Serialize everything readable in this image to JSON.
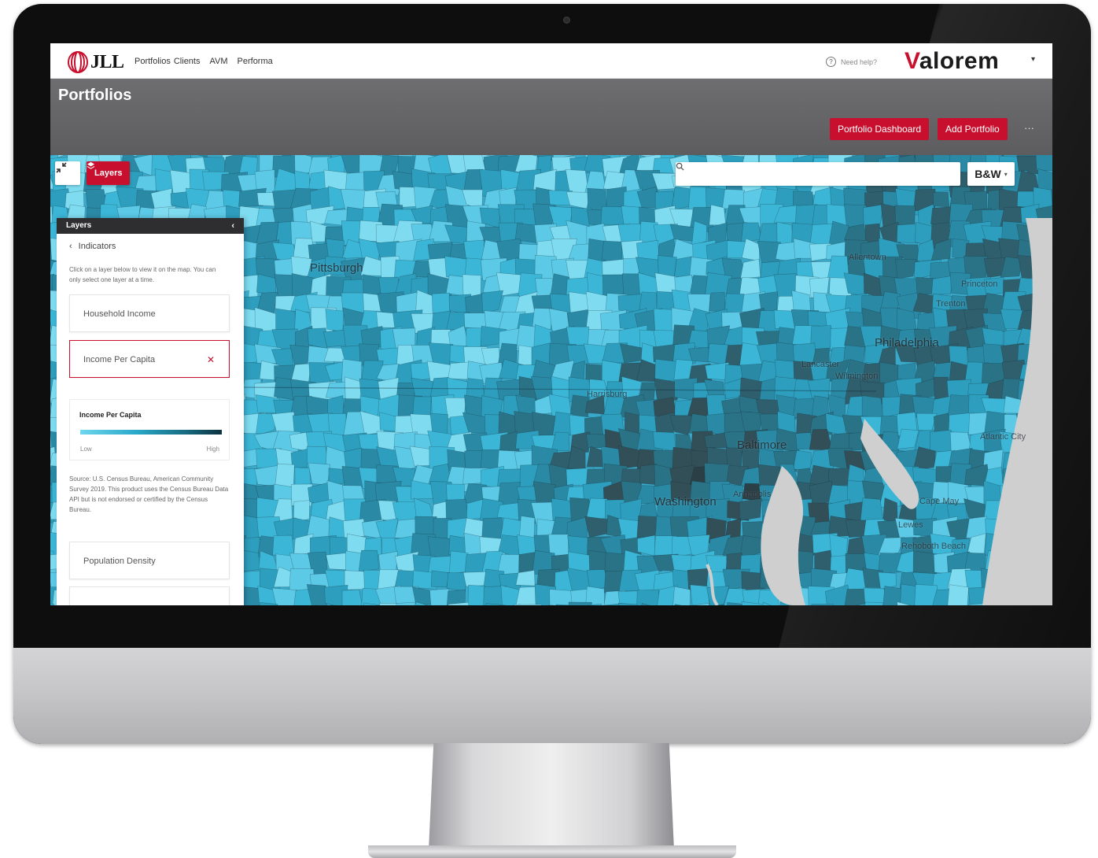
{
  "app": {
    "logo_text": "JLL",
    "nav": [
      "Portfolios",
      "Clients",
      "AVM",
      "Performa"
    ],
    "help_label": "Need help?",
    "brand_name": "alorem",
    "brand_initial": "V"
  },
  "header": {
    "page_title": "Portfolios",
    "dashboard_button": "Portfolio Dashboard",
    "add_button": "Add Portfolio",
    "more_label": "···"
  },
  "map_controls": {
    "layers_button": "Layers",
    "search_placeholder": "",
    "style_button": "B&W"
  },
  "layers_panel": {
    "title": "Layers",
    "back_label": "Indicators",
    "description": "Click on a layer below to view it on the map. You can only select one layer at a time.",
    "cards": [
      {
        "label": "Household Income",
        "active": false
      },
      {
        "label": "Income Per Capita",
        "active": true
      },
      {
        "label": "Population Density",
        "active": false
      }
    ],
    "legend": {
      "title": "Income Per Capita",
      "low_label": "Low",
      "high_label": "High"
    },
    "source": "Source: U.S. Census Bureau, American Community Survey 2019. This product uses the Census Bureau Data API but is not endorsed or certified by the Census Bureau."
  },
  "map_labels": [
    "Pittsburgh",
    "Allentown",
    "Trenton",
    "Philadelphia",
    "Wilmington",
    "Baltimore",
    "Washington",
    "Princeton",
    "Lancaster",
    "Harrisburg",
    "Annapolis",
    "Cape May",
    "Lewes",
    "Rehoboth Beach",
    "Atlantic City"
  ],
  "colors": {
    "accent": "#c8102e",
    "map_light": "#6fd6ee",
    "map_dark": "#0c3240"
  }
}
